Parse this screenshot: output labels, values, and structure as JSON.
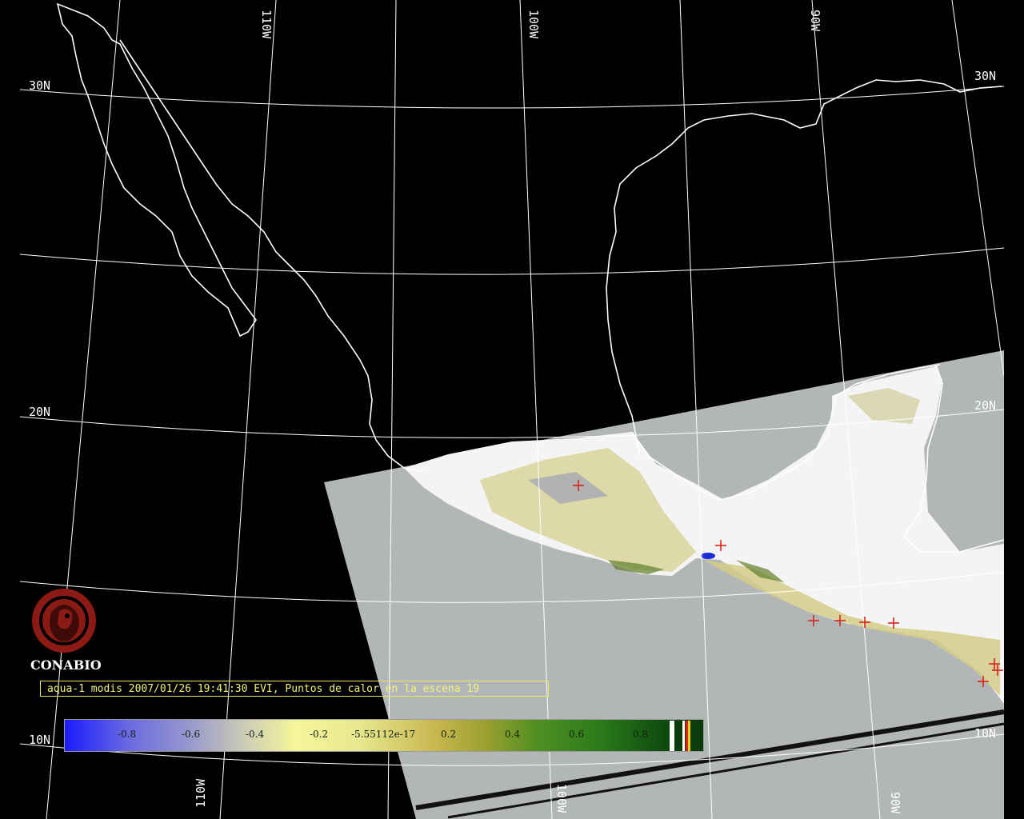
{
  "map": {
    "longitude_labels": [
      "110W",
      "100W",
      "90W"
    ],
    "latitude_labels": [
      "30N",
      "20N",
      "10N"
    ],
    "colors": {
      "background": "#000000",
      "graticule": "#ffffff",
      "swath_fill": "#b3b6b7",
      "cloud": "#ffffff",
      "fire_marker": "#d8241e"
    }
  },
  "logo": {
    "name": "CONABIO",
    "icon": "conabio-logo-icon",
    "color": "#8b1a14"
  },
  "caption": {
    "text": "aqua-1 modis 2007/01/26 19:41:30 EVI, Puntos de calor en la escena 19"
  },
  "colorbar": {
    "ticks": [
      "-0.8",
      "-0.6",
      "-0.4",
      "-0.2",
      "-5.55112e-17",
      "0.2",
      "0.4",
      "0.6",
      "0.8"
    ]
  }
}
